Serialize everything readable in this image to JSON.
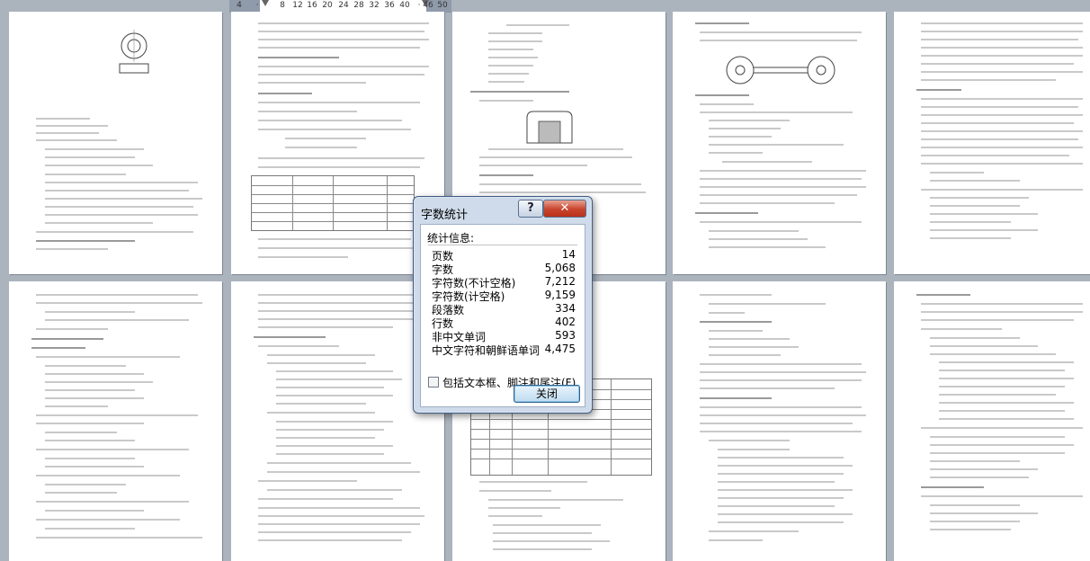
{
  "ruler": {
    "ticks": [
      "4",
      "·",
      "8",
      "12",
      "16",
      "20",
      "24",
      "28",
      "32",
      "36",
      "40",
      "·",
      "46",
      "50"
    ]
  },
  "dialog": {
    "title": "字数统计",
    "help_glyph": "?",
    "close_glyph": "✕",
    "group_label": "统计信息:",
    "stats": [
      {
        "label": "页数",
        "value": "14"
      },
      {
        "label": "字数",
        "value": "5,068"
      },
      {
        "label": "字符数(不计空格)",
        "value": "7,212"
      },
      {
        "label": "字符数(计空格)",
        "value": "9,159"
      },
      {
        "label": "段落数",
        "value": "334"
      },
      {
        "label": "行数",
        "value": "402"
      },
      {
        "label": "非中文单词",
        "value": "593"
      },
      {
        "label": "中文字符和朝鲜语单词",
        "value": "4,475"
      }
    ],
    "checkbox_label": "包括文本框、脚注和尾注(F)",
    "checkbox_checked": false,
    "close_button": "关闭"
  },
  "colors": {
    "workspace": "#abb3bd",
    "dialog_frame": "#cfdbea",
    "close_red": "#c8432c"
  }
}
